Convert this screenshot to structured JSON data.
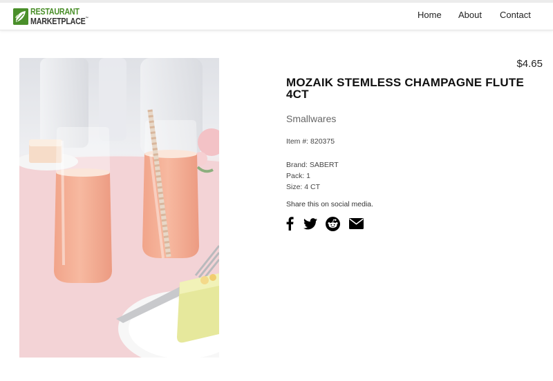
{
  "header": {
    "logo": {
      "line1": "RESTAURANT",
      "line2": "MARKETPLACE",
      "trademark": "™",
      "brand_color": "#4a8f2a"
    },
    "nav": [
      {
        "label": "Home"
      },
      {
        "label": "About"
      },
      {
        "label": "Contact"
      }
    ]
  },
  "product": {
    "price": "$4.65",
    "title": "MOZAIK STEMLESS CHAMPAGNE FLUTE 4CT",
    "category": "Smallwares",
    "item_number": "Item #: 820375",
    "brand": "Brand: SABERT",
    "pack": "Pack: 1",
    "size": "Size: 4 CT",
    "image_icon": "product-photo-champagne-flutes"
  },
  "share": {
    "label": "Share this on social media.",
    "icons": [
      "facebook-icon",
      "twitter-icon",
      "reddit-icon",
      "email-icon"
    ]
  }
}
